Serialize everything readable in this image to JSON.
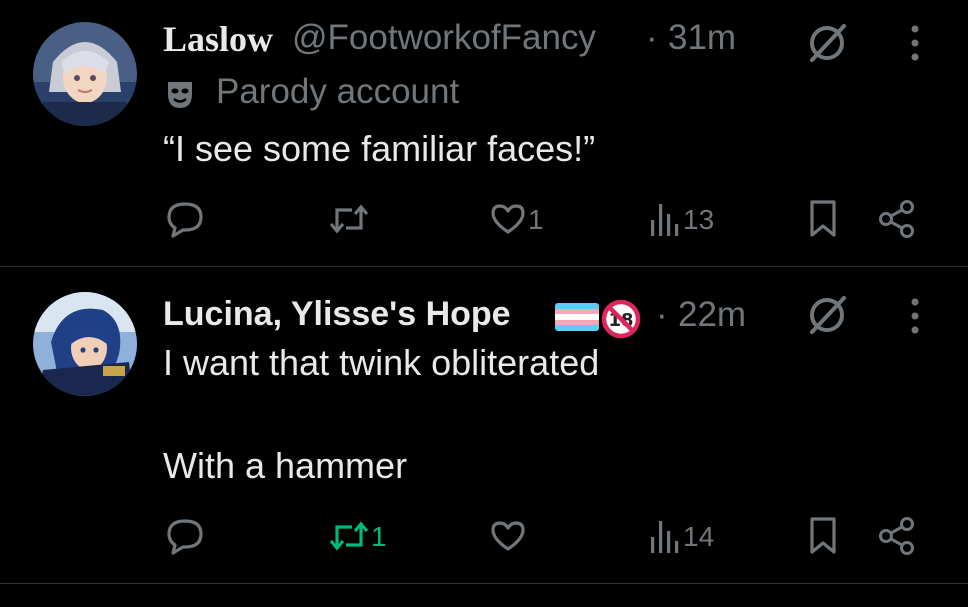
{
  "tweets": [
    {
      "display_name": "Laslow",
      "handle": "@FootworkofFancy",
      "separator": "·",
      "time": "31m",
      "label": "Parody account",
      "text_lines": [
        "“I see some familiar faces!”"
      ],
      "likes": "1",
      "views": "13",
      "retweets": "",
      "icons": [
        "reply-icon",
        "retweet-icon",
        "heart-icon",
        "views-icon",
        "bookmark-icon",
        "share-icon",
        "grok-icon",
        "more-icon",
        "parody-mask-icon"
      ]
    },
    {
      "display_name": "Lucina, Ylisse's Hope",
      "separator": "·",
      "time": "22m",
      "text_lines": [
        "I want that twink obliterated",
        "With a hammer"
      ],
      "retweets": "1",
      "likes": "",
      "views": "14",
      "icons": [
        "reply-icon",
        "retweet-icon",
        "heart-icon",
        "views-icon",
        "bookmark-icon",
        "share-icon",
        "grok-icon",
        "more-icon",
        "trans-flag-emoji",
        "no-under-18-emoji"
      ]
    }
  ],
  "colors": {
    "background": "#000000",
    "text": "#e7e9ea",
    "muted": "#71767b",
    "retweet_active": "#00ba7c",
    "divider": "#2f3336"
  }
}
